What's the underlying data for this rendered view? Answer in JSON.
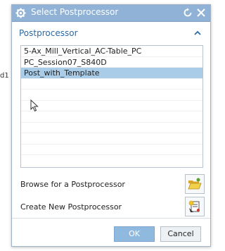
{
  "background": {
    "fragment_text": "d1"
  },
  "dialog": {
    "title": "Select Postprocessor",
    "section_title": "Postprocessor",
    "postprocessors": [
      "5-Ax_Mill_Vertical_AC-Table_PC",
      "PC_Session07_S840D",
      "Post_with_Template"
    ],
    "selected_index": 2,
    "empty_rows": 7,
    "browse_label": "Browse for a Postprocessor",
    "create_label": "Create New Postprocessor",
    "ok_label": "OK",
    "cancel_label": "Cancel",
    "colors": {
      "titlebar": "#8fb2d6",
      "section_title": "#2a6aa5",
      "selected_row": "#a9cde9",
      "ok_button": "#8fb9de"
    }
  }
}
